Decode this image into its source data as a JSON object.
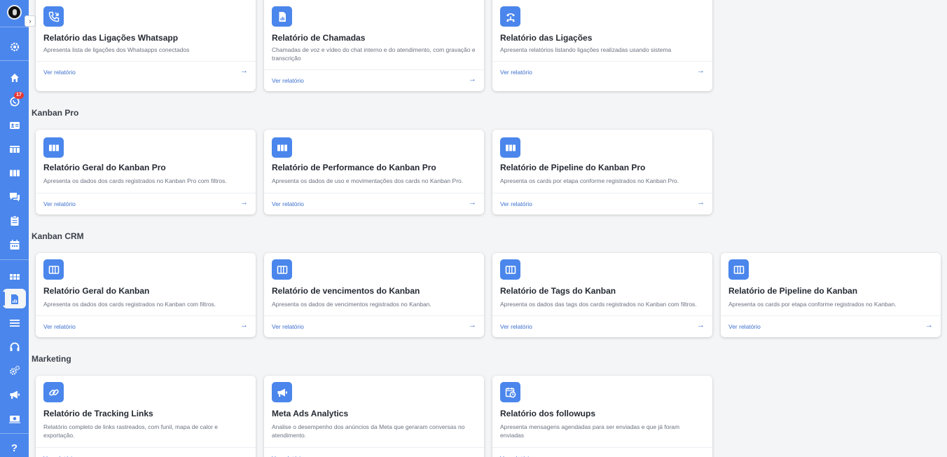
{
  "sidebar": {
    "badge_count": "17",
    "expand_label": "›",
    "help_label": "?",
    "icons": [
      "settings-icon",
      "home-icon",
      "whatsapp-icon",
      "contact-card-icon",
      "kanban-icon",
      "kanban-pro-icon",
      "chat-icon",
      "clipboard-icon",
      "calendar-icon",
      "dashboard-icon",
      "reports-icon",
      "list-icon",
      "headset-icon",
      "gears-icon",
      "megaphone-icon",
      "money-icon",
      "help-icon"
    ]
  },
  "colors": {
    "accent": "#4a86ec",
    "link": "#3d6fcf",
    "badge": "#e53935"
  },
  "link_label": "Ver relatório",
  "arrow": "→",
  "sections": [
    {
      "title": "Kanban Pro"
    },
    {
      "title": "Kanban CRM"
    },
    {
      "title": "Marketing"
    }
  ],
  "cards": {
    "top": [
      {
        "icon": "phone-transfer-icon",
        "title": "Relatório das Ligações Whatsapp",
        "desc": "Apresenta lista de ligações dos Whatsapps conectados"
      },
      {
        "icon": "chart-file-icon",
        "title": "Relatório de Chamadas",
        "desc": "Chamadas de voz e vídeo do chat interno e do atendimento, com gravação e transcrição"
      },
      {
        "icon": "phone-network-icon",
        "title": "Relatório das Ligações",
        "desc": "Apresenta relatórios listando ligações realizadas usando sistema"
      }
    ],
    "kanban_pro": [
      {
        "icon": "kanban-board-icon",
        "title": "Relatório Geral do Kanban Pro",
        "desc": "Apresenta os dados dos cards registrados no Kanban Pro com filtros."
      },
      {
        "icon": "kanban-board-icon",
        "title": "Relatório de Performance do Kanban Pro",
        "desc": "Apresenta os dados de uso e movimentações dos cards no Kanban Pro."
      },
      {
        "icon": "kanban-board-icon",
        "title": "Relatório de Pipeline do Kanban Pro",
        "desc": "Apresenta os cards por etapa conforme registrados no Kanban Pro."
      }
    ],
    "kanban_crm": [
      {
        "icon": "kanban-columns-icon",
        "title": "Relatório Geral do Kanban",
        "desc": "Apresenta os dados dos cards registrados no Kanban com filtros."
      },
      {
        "icon": "kanban-columns-icon",
        "title": "Relatório de vencimentos do Kanban",
        "desc": "Apresenta os dados de vencimentos registrados no Kanban."
      },
      {
        "icon": "kanban-columns-icon",
        "title": "Relatório de Tags do Kanban",
        "desc": "Apresenta os dados das tags dos cards registrados no Kanban com filtros."
      },
      {
        "icon": "kanban-columns-icon",
        "title": "Relatório de Pipeline do Kanban",
        "desc": "Apresenta os cards por etapa conforme registrados no Kanban."
      }
    ],
    "marketing": [
      {
        "icon": "link-icon",
        "title": "Relatório de Tracking Links",
        "desc": "Relatório completo de links rastreados, com funil, mapa de calor e exportação."
      },
      {
        "icon": "megaphone-icon",
        "title": "Meta Ads Analytics",
        "desc": "Analise o desempenho dos anúncios da Meta que geraram conversas no atendimento."
      },
      {
        "icon": "calendar-clock-icon",
        "title": "Relatório dos followups",
        "desc": "Apresenta mensagens agendadas para ser enviadas e que já foram enviadas"
      }
    ]
  }
}
